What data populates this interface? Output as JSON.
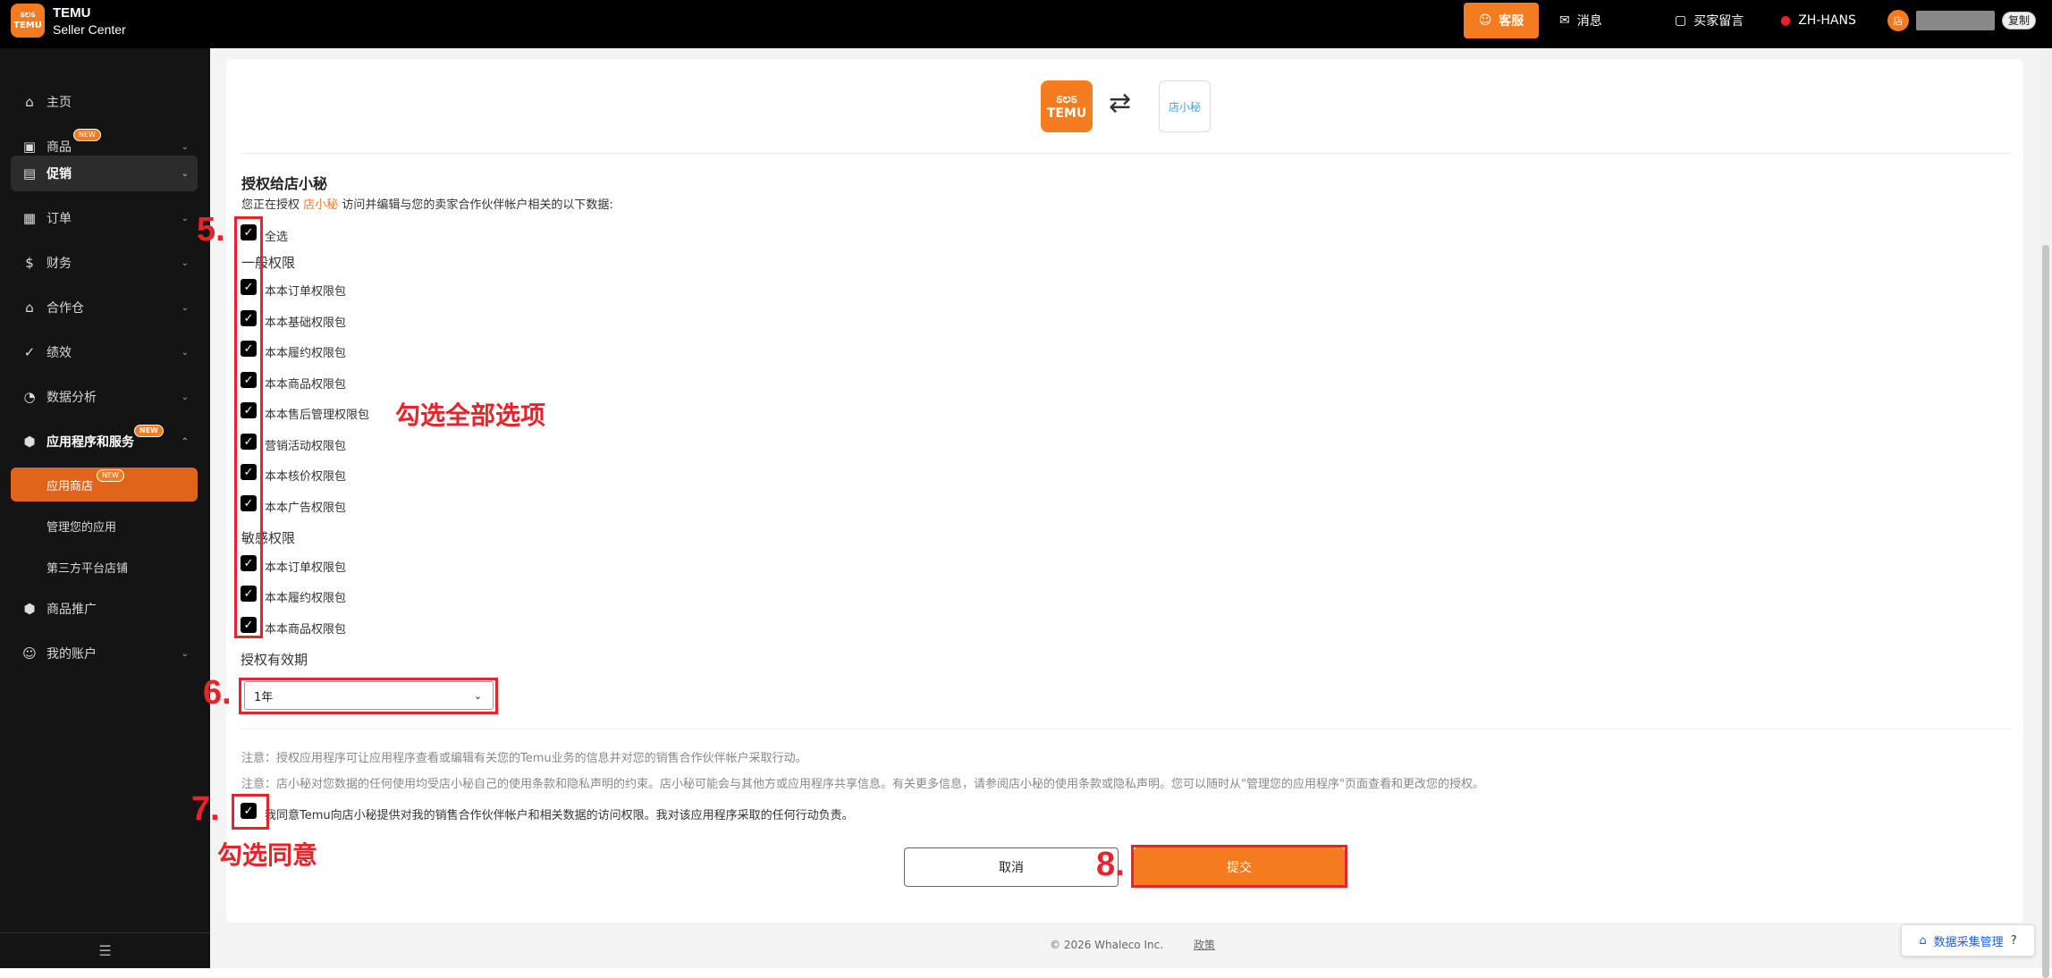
{
  "brand": {
    "logo_line1": "ಽಲಽ",
    "logo_line2": "TEMU",
    "name": "TEMU",
    "subtitle": "Seller Center"
  },
  "topbar": {
    "kefu": "客服",
    "messages": "消息",
    "buyer_messages": "买家留言",
    "language": "ZH-HANS",
    "avatar_initial": "店",
    "copy": "复制"
  },
  "sidebar": {
    "items": [
      {
        "label": "主页",
        "icon": "home-icon"
      },
      {
        "label": "商品",
        "icon": "bag-icon",
        "badge": "NEW"
      },
      {
        "label": "促销",
        "icon": "promo-icon"
      },
      {
        "label": "订单",
        "icon": "order-icon"
      },
      {
        "label": "财务",
        "icon": "dollar-icon"
      },
      {
        "label": "合作仓",
        "icon": "warehouse-icon"
      },
      {
        "label": "绩效",
        "icon": "check-circle-icon"
      },
      {
        "label": "数据分析",
        "icon": "pie-icon"
      },
      {
        "label": "应用程序和服务",
        "icon": "cube-icon",
        "badge": "NEW"
      },
      {
        "label": "商品推广",
        "icon": "cube-icon"
      },
      {
        "label": "我的账户",
        "icon": "user-icon"
      }
    ],
    "sub_items": [
      {
        "label": "应用商店",
        "badge": "NEW"
      },
      {
        "label": "管理您的应用"
      },
      {
        "label": "第三方平台店铺"
      }
    ]
  },
  "auth": {
    "partner_logo_text": "店小秘",
    "title": "授权给店小秘",
    "desc_prefix": "您正在授权",
    "desc_app": "店小秘",
    "desc_suffix": "访问并编辑与您的卖家合作伙伴帐户相关的以下数据:",
    "select_all": "全选",
    "general_label": "一般权限",
    "general": [
      "本本订单权限包",
      "本本基础权限包",
      "本本履约权限包",
      "本本商品权限包",
      "本本售后管理权限包",
      "营销活动权限包",
      "本本核价权限包",
      "本本广告权限包"
    ],
    "sensitive_label": "敏感权限",
    "sensitive": [
      "本本订单权限包",
      "本本履约权限包",
      "本本商品权限包"
    ],
    "validity_label": "授权有效期",
    "validity_value": "1年",
    "note1": "注意：授权应用程序可让应用程序查看或编辑有关您的Temu业务的信息并对您的销售合作伙伴帐户采取行动。",
    "note2": "注意：店小秘对您数据的任何使用均受店小秘自己的使用条款和隐私声明的约束。店小秘可能会与其他方或应用程序共享信息。有关更多信息，请参阅店小秘的使用条款或隐私声明。您可以随时从\"管理您的应用程序\"页面查看和更改您的授权。",
    "agree": "我同意Temu向店小秘提供对我的销售合作伙伴帐户和相关数据的访问权限。我对该应用程序采取的任何行动负责。",
    "cancel": "取消",
    "submit": "提交"
  },
  "annotations": {
    "n5": "5.",
    "n6": "6.",
    "n7": "7.",
    "n8": "8.",
    "check_all": "勾选全部选项",
    "check_agree": "勾选同意"
  },
  "footer": {
    "copyright": "© 2026 Whaleco Inc.",
    "policy": "政策"
  },
  "float_button": "数据采集管理"
}
